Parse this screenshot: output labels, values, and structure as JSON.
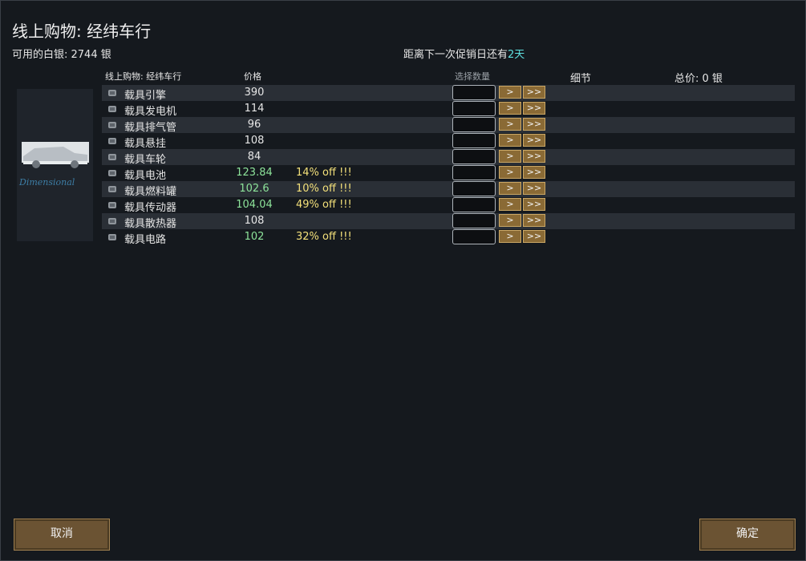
{
  "title": "线上购物: 经纬车行",
  "silver_text": "可用的白银: 2744 银",
  "sale": {
    "prefix": "距离下一次促销日还有",
    "days": "2天"
  },
  "headers": {
    "shop": "线上购物: 经纬车行",
    "price": "价格",
    "qty": "选择数量",
    "detail": "细节",
    "total": "总价: 0 银"
  },
  "logo_text": "Dimensional",
  "buttons": {
    "step": ">",
    "step_max": ">>",
    "cancel": "取消",
    "confirm": "确定"
  },
  "items": [
    {
      "name": "载具引擎",
      "price": "390",
      "off": "",
      "icon": "engine-icon"
    },
    {
      "name": "载具发电机",
      "price": "114",
      "off": "",
      "icon": "generator-icon"
    },
    {
      "name": "载具排气管",
      "price": "96",
      "off": "",
      "icon": "exhaust-icon"
    },
    {
      "name": "载具悬挂",
      "price": "108",
      "off": "",
      "icon": "suspension-icon"
    },
    {
      "name": "载具车轮",
      "price": "84",
      "off": "",
      "icon": "wheel-icon"
    },
    {
      "name": "载具电池",
      "price": "123.84",
      "off": "14% off !!!",
      "icon": "battery-icon"
    },
    {
      "name": "载具燃料罐",
      "price": "102.6",
      "off": "10% off !!!",
      "icon": "fuel-tank-icon"
    },
    {
      "name": "载具传动器",
      "price": "104.04",
      "off": "49% off !!!",
      "icon": "transmission-icon"
    },
    {
      "name": "载具散热器",
      "price": "108",
      "off": "",
      "icon": "radiator-icon"
    },
    {
      "name": "载具电路",
      "price": "102",
      "off": "32% off !!!",
      "icon": "circuit-icon"
    }
  ]
}
